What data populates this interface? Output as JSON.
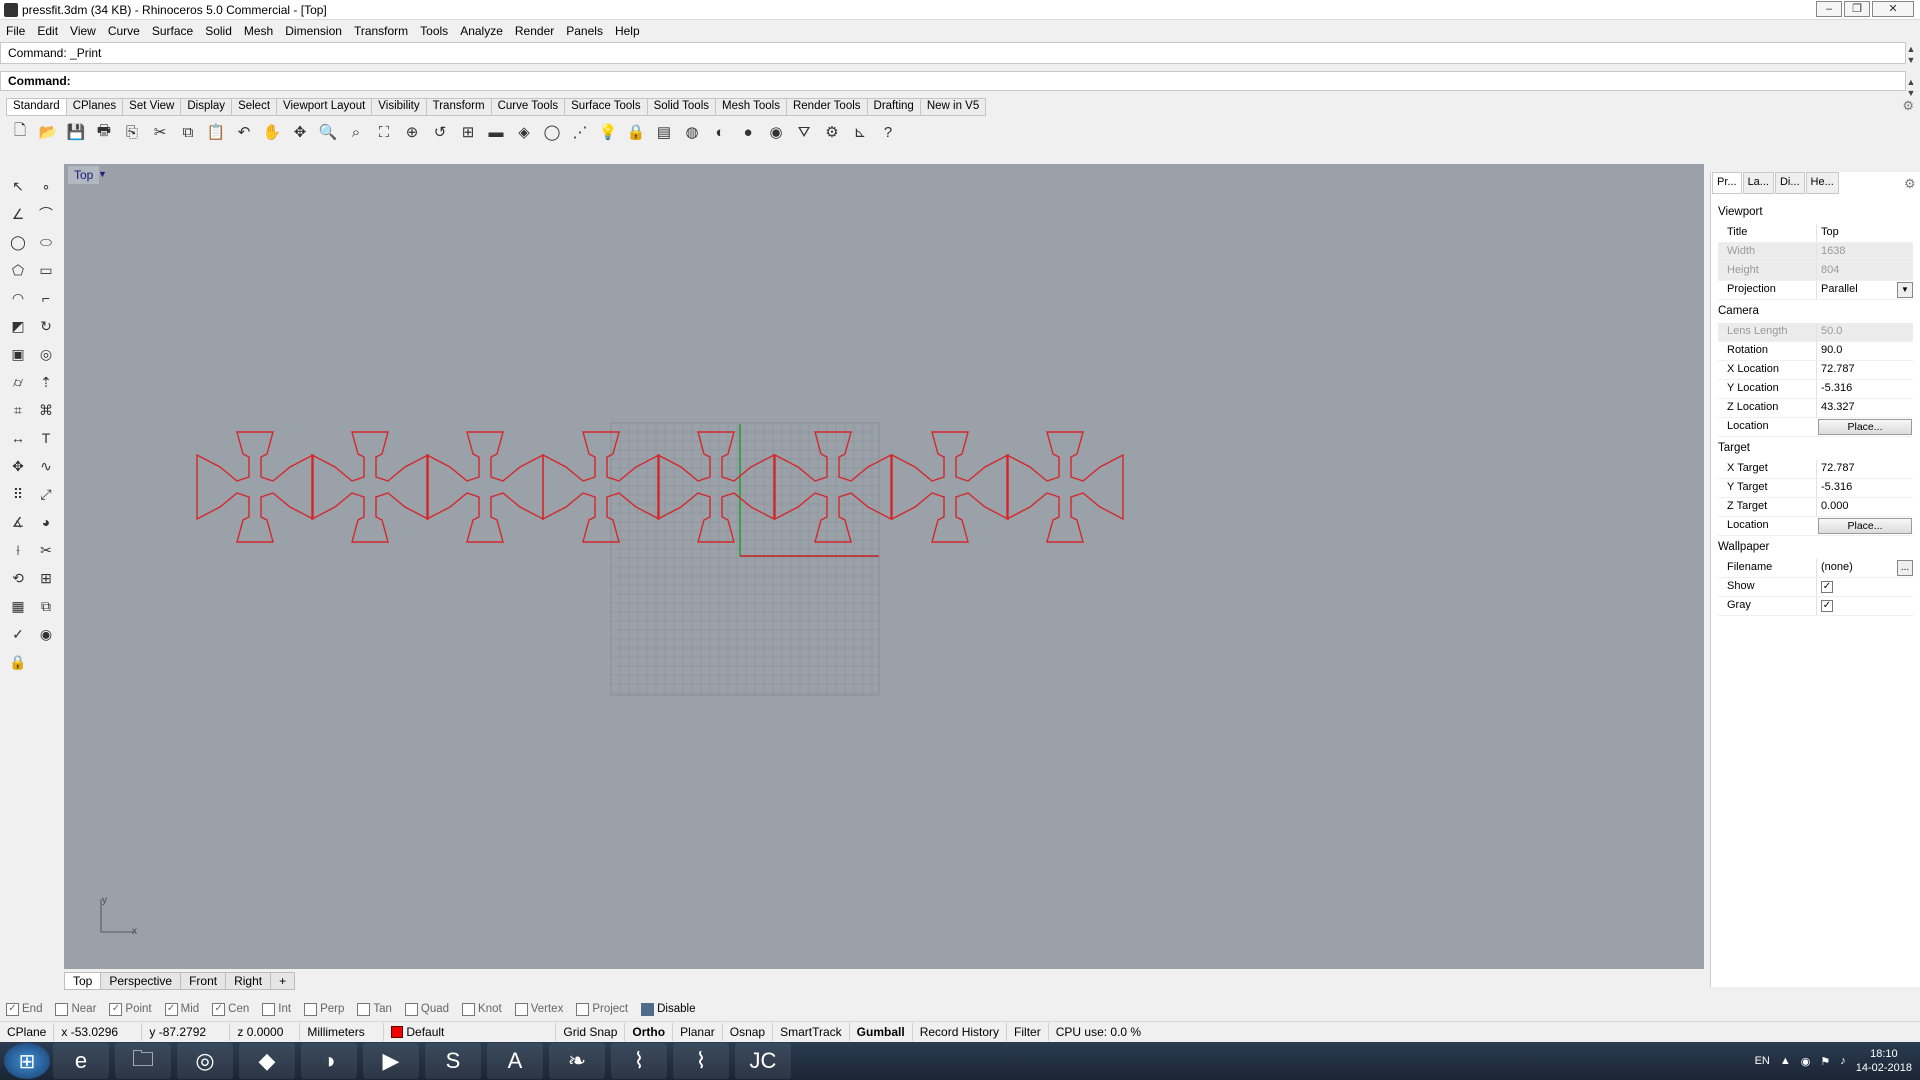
{
  "window": {
    "title": "pressfit.3dm (34 KB) - Rhinoceros 5.0 Commercial - [Top]",
    "minimize": "–",
    "maximize": "❐",
    "close": "✕"
  },
  "menu": [
    "File",
    "Edit",
    "View",
    "Curve",
    "Surface",
    "Solid",
    "Mesh",
    "Dimension",
    "Transform",
    "Tools",
    "Analyze",
    "Render",
    "Panels",
    "Help"
  ],
  "command": {
    "history": "Command: _Print",
    "prompt": "Command:"
  },
  "toolbar_tabs": [
    "Standard",
    "CPlanes",
    "Set View",
    "Display",
    "Select",
    "Viewport Layout",
    "Visibility",
    "Transform",
    "Curve Tools",
    "Surface Tools",
    "Solid Tools",
    "Mesh Tools",
    "Render Tools",
    "Drafting",
    "New in V5"
  ],
  "toolbar_icons": [
    "new-icon",
    "open-icon",
    "save-icon",
    "print-icon",
    "import-icon",
    "cut-icon",
    "copy-icon",
    "paste-icon",
    "undo-icon",
    "pan-icon",
    "rotate-icon",
    "zoom-icon",
    "zoom-window-icon",
    "zoom-extents-icon",
    "zoom-selected-icon",
    "undo-view-icon",
    "four-viewports-icon",
    "car-icon",
    "osnap-icon",
    "circle-icon",
    "lines-icon",
    "bulb-icon",
    "lock-icon",
    "layers-icon",
    "color-wheel-icon",
    "shade-icon",
    "render-icon",
    "sphere-icon",
    "filter-icon",
    "gear-icon",
    "dimension-icon",
    "help-icon"
  ],
  "viewport": {
    "name": "Top",
    "tabs": [
      "Top",
      "Perspective",
      "Front",
      "Right",
      "+"
    ],
    "axis_y": "y",
    "axis_x": "x"
  },
  "panel": {
    "tabs": [
      "Pr...",
      "La...",
      "Di...",
      "He..."
    ],
    "sections": {
      "viewport": "Viewport",
      "camera": "Camera",
      "target": "Target",
      "wallpaper": "Wallpaper"
    },
    "rows": {
      "title": {
        "k": "Title",
        "v": "Top"
      },
      "width": {
        "k": "Width",
        "v": "1638"
      },
      "height": {
        "k": "Height",
        "v": "804"
      },
      "projection": {
        "k": "Projection",
        "v": "Parallel"
      },
      "lens": {
        "k": "Lens Length",
        "v": "50.0"
      },
      "rotation": {
        "k": "Rotation",
        "v": "90.0"
      },
      "xloc": {
        "k": "X Location",
        "v": "72.787"
      },
      "yloc": {
        "k": "Y Location",
        "v": "-5.316"
      },
      "zloc": {
        "k": "Z Location",
        "v": "43.327"
      },
      "loc": {
        "k": "Location",
        "v": "Place..."
      },
      "xt": {
        "k": "X Target",
        "v": "72.787"
      },
      "yt": {
        "k": "Y Target",
        "v": "-5.316"
      },
      "zt": {
        "k": "Z Target",
        "v": "0.000"
      },
      "tloc": {
        "k": "Location",
        "v": "Place..."
      },
      "filename": {
        "k": "Filename",
        "v": "(none)"
      },
      "show": {
        "k": "Show",
        "v": "✓"
      },
      "gray": {
        "k": "Gray",
        "v": "✓"
      }
    },
    "browse": "..."
  },
  "osnap": [
    {
      "label": "End",
      "checked": true
    },
    {
      "label": "Near",
      "checked": false
    },
    {
      "label": "Point",
      "checked": true
    },
    {
      "label": "Mid",
      "checked": true
    },
    {
      "label": "Cen",
      "checked": true
    },
    {
      "label": "Int",
      "checked": false
    },
    {
      "label": "Perp",
      "checked": false
    },
    {
      "label": "Tan",
      "checked": false
    },
    {
      "label": "Quad",
      "checked": false
    },
    {
      "label": "Knot",
      "checked": false
    },
    {
      "label": "Vertex",
      "checked": false
    },
    {
      "label": "Project",
      "checked": false
    }
  ],
  "osnap_disable": "Disable",
  "status": {
    "cplane": "CPlane",
    "x": "x -53.0296",
    "y": "y -87.2792",
    "z": "z 0.0000",
    "units": "Millimeters",
    "layer": "Default",
    "grid_snap": "Grid Snap",
    "ortho": "Ortho",
    "planar": "Planar",
    "osnap": "Osnap",
    "smarttrack": "SmartTrack",
    "gumball": "Gumball",
    "record_history": "Record History",
    "filter": "Filter",
    "cpu": "CPU use: 0.0 %"
  },
  "taskbar": {
    "apps": [
      "internet-explorer-icon",
      "file-explorer-icon",
      "chrome-icon",
      "inkscape-icon",
      "app-icon",
      "media-player-icon",
      "sublime-icon",
      "acrobat-icon",
      "app-green-icon",
      "app-cut-icon",
      "app-cut2-icon",
      "rhino-icon"
    ],
    "lang": "EN",
    "time": "18:10",
    "date": "14-02-2018"
  },
  "colors": {
    "viewport_bg": "#9aa1a9",
    "curve_red": "#d4272a",
    "grid": "#8b9098"
  }
}
